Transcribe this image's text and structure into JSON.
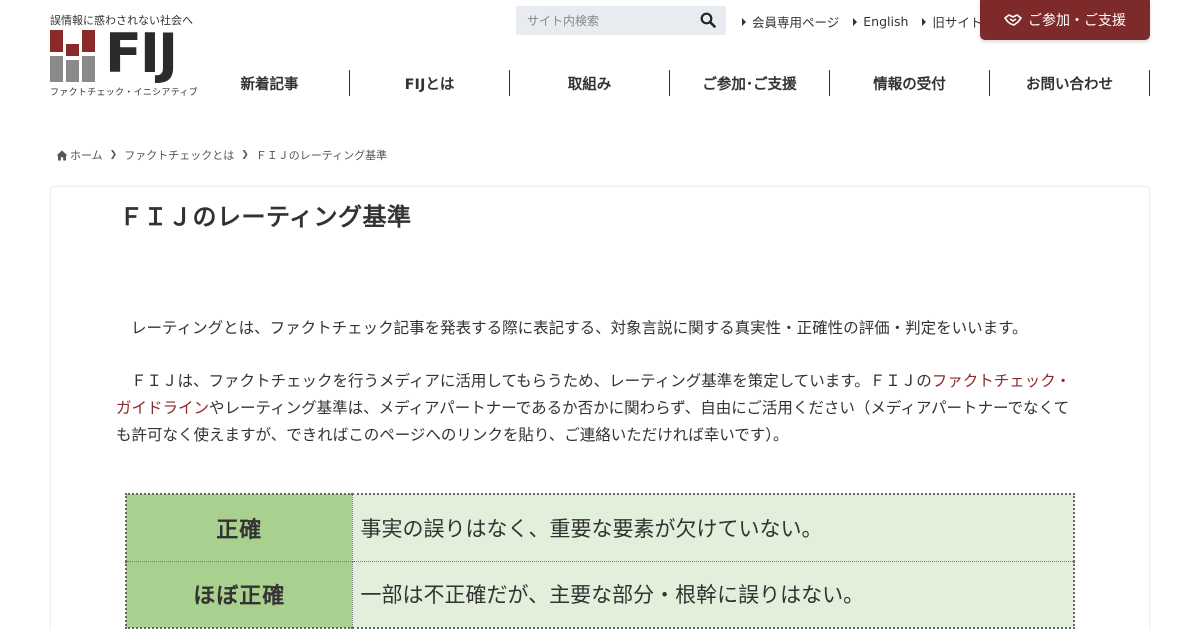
{
  "header": {
    "tagline": "誤情報に惑わされない社会へ",
    "logo_text": "FIJ",
    "logo_sub": "ファクトチェック・イニシアティブ",
    "search_placeholder": "サイト内検索",
    "top_links": [
      "会員専用ページ",
      "English",
      "旧サイト"
    ],
    "cta_label": "ご参加・ご支援"
  },
  "nav": [
    "新着記事",
    "FIJとは",
    "取組み",
    "ご参加･ご支援",
    "情報の受付",
    "お問い合わせ"
  ],
  "breadcrumb": {
    "home": "ホーム",
    "parent": "ファクトチェックとは",
    "current": "ＦＩＪのレーティング基準"
  },
  "main": {
    "title": "ＦＩＪのレーティング基準",
    "para1": "レーティングとは、ファクトチェック記事を発表する際に表記する、対象言説に関する真実性・正確性の評価・判定をいいます。",
    "para2_a": "ＦＩＪは、ファクトチェックを行うメディアに活用してもらうため、レーティング基準を策定しています。ＦＩＪの",
    "para2_link": "ファクトチェック・ガイドライン",
    "para2_b": "やレーティング基準は、メディアパートナーであるか否かに関わらず、自由にご活用ください（メディアパートナーでなくても許可なく使えますが、できればこのページへのリンクを貼り、ご連絡いただければ幸いです）。"
  },
  "ratings": [
    {
      "label": "正確",
      "desc": "事実の誤りはなく、重要な要素が欠けていない。"
    },
    {
      "label": "ほぼ正確",
      "desc": "一部は不正確だが、主要な部分・根幹に誤りはない。"
    }
  ],
  "colors": {
    "brand": "#7e2a2a",
    "link": "#8b2a2a",
    "rating_label_bg": "#a9d08e",
    "rating_desc_bg": "#e2efda"
  },
  "icons": {
    "search": "search-icon",
    "home": "home-icon",
    "handshake": "handshake-icon"
  }
}
